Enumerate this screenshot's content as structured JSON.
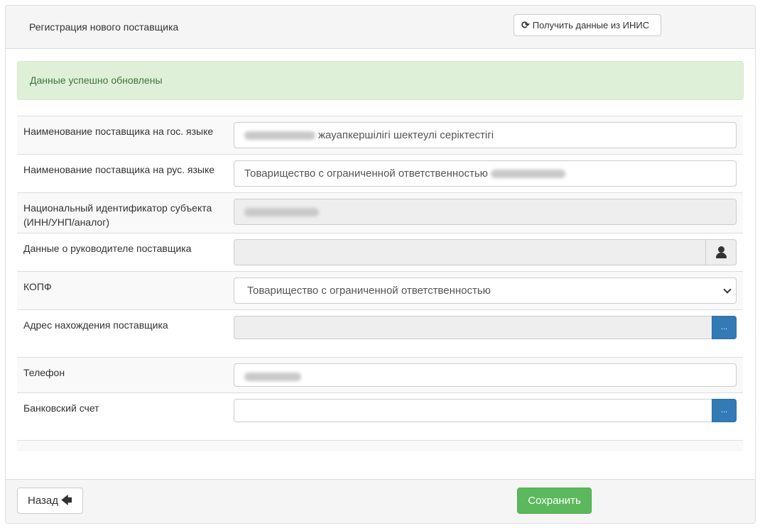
{
  "header": {
    "title": "Регистрация нового поставщика",
    "inis_button_label": "Получить данные из ИНИС",
    "inis_button_icon": "refresh-icon"
  },
  "alert": {
    "message": "Данные успешно обновлены",
    "color": "#3c763d",
    "background": "#dff0d8"
  },
  "form": {
    "name_kz": {
      "label": "Наименование поставщика на гос. языке",
      "value_visible": "жауапкершілігі шектеулі серіктестігі"
    },
    "name_ru": {
      "label": "Наименование поставщика на рус. языке",
      "value_visible": "Товарищество с ограниченной ответственностью"
    },
    "national_id": {
      "label": "Национальный идентификатор субъекта (ИНН/УНП/аналог)"
    },
    "director": {
      "label": "Данные о руководителе поставщика",
      "addon_icon": "user-icon"
    },
    "kopf": {
      "label": "КОПФ",
      "selected": "Товарищество с ограниченной ответственностью"
    },
    "address": {
      "label": "Адрес нахождения поставщика",
      "button_label": "..."
    },
    "phone": {
      "label": "Телефон"
    },
    "bank_account": {
      "label": "Банковский счет",
      "button_label": "..."
    }
  },
  "footer": {
    "back_label": "Назад",
    "back_icon": "arrow-left-icon",
    "save_label": "Сохранить",
    "save_color": "#5cb85c"
  }
}
